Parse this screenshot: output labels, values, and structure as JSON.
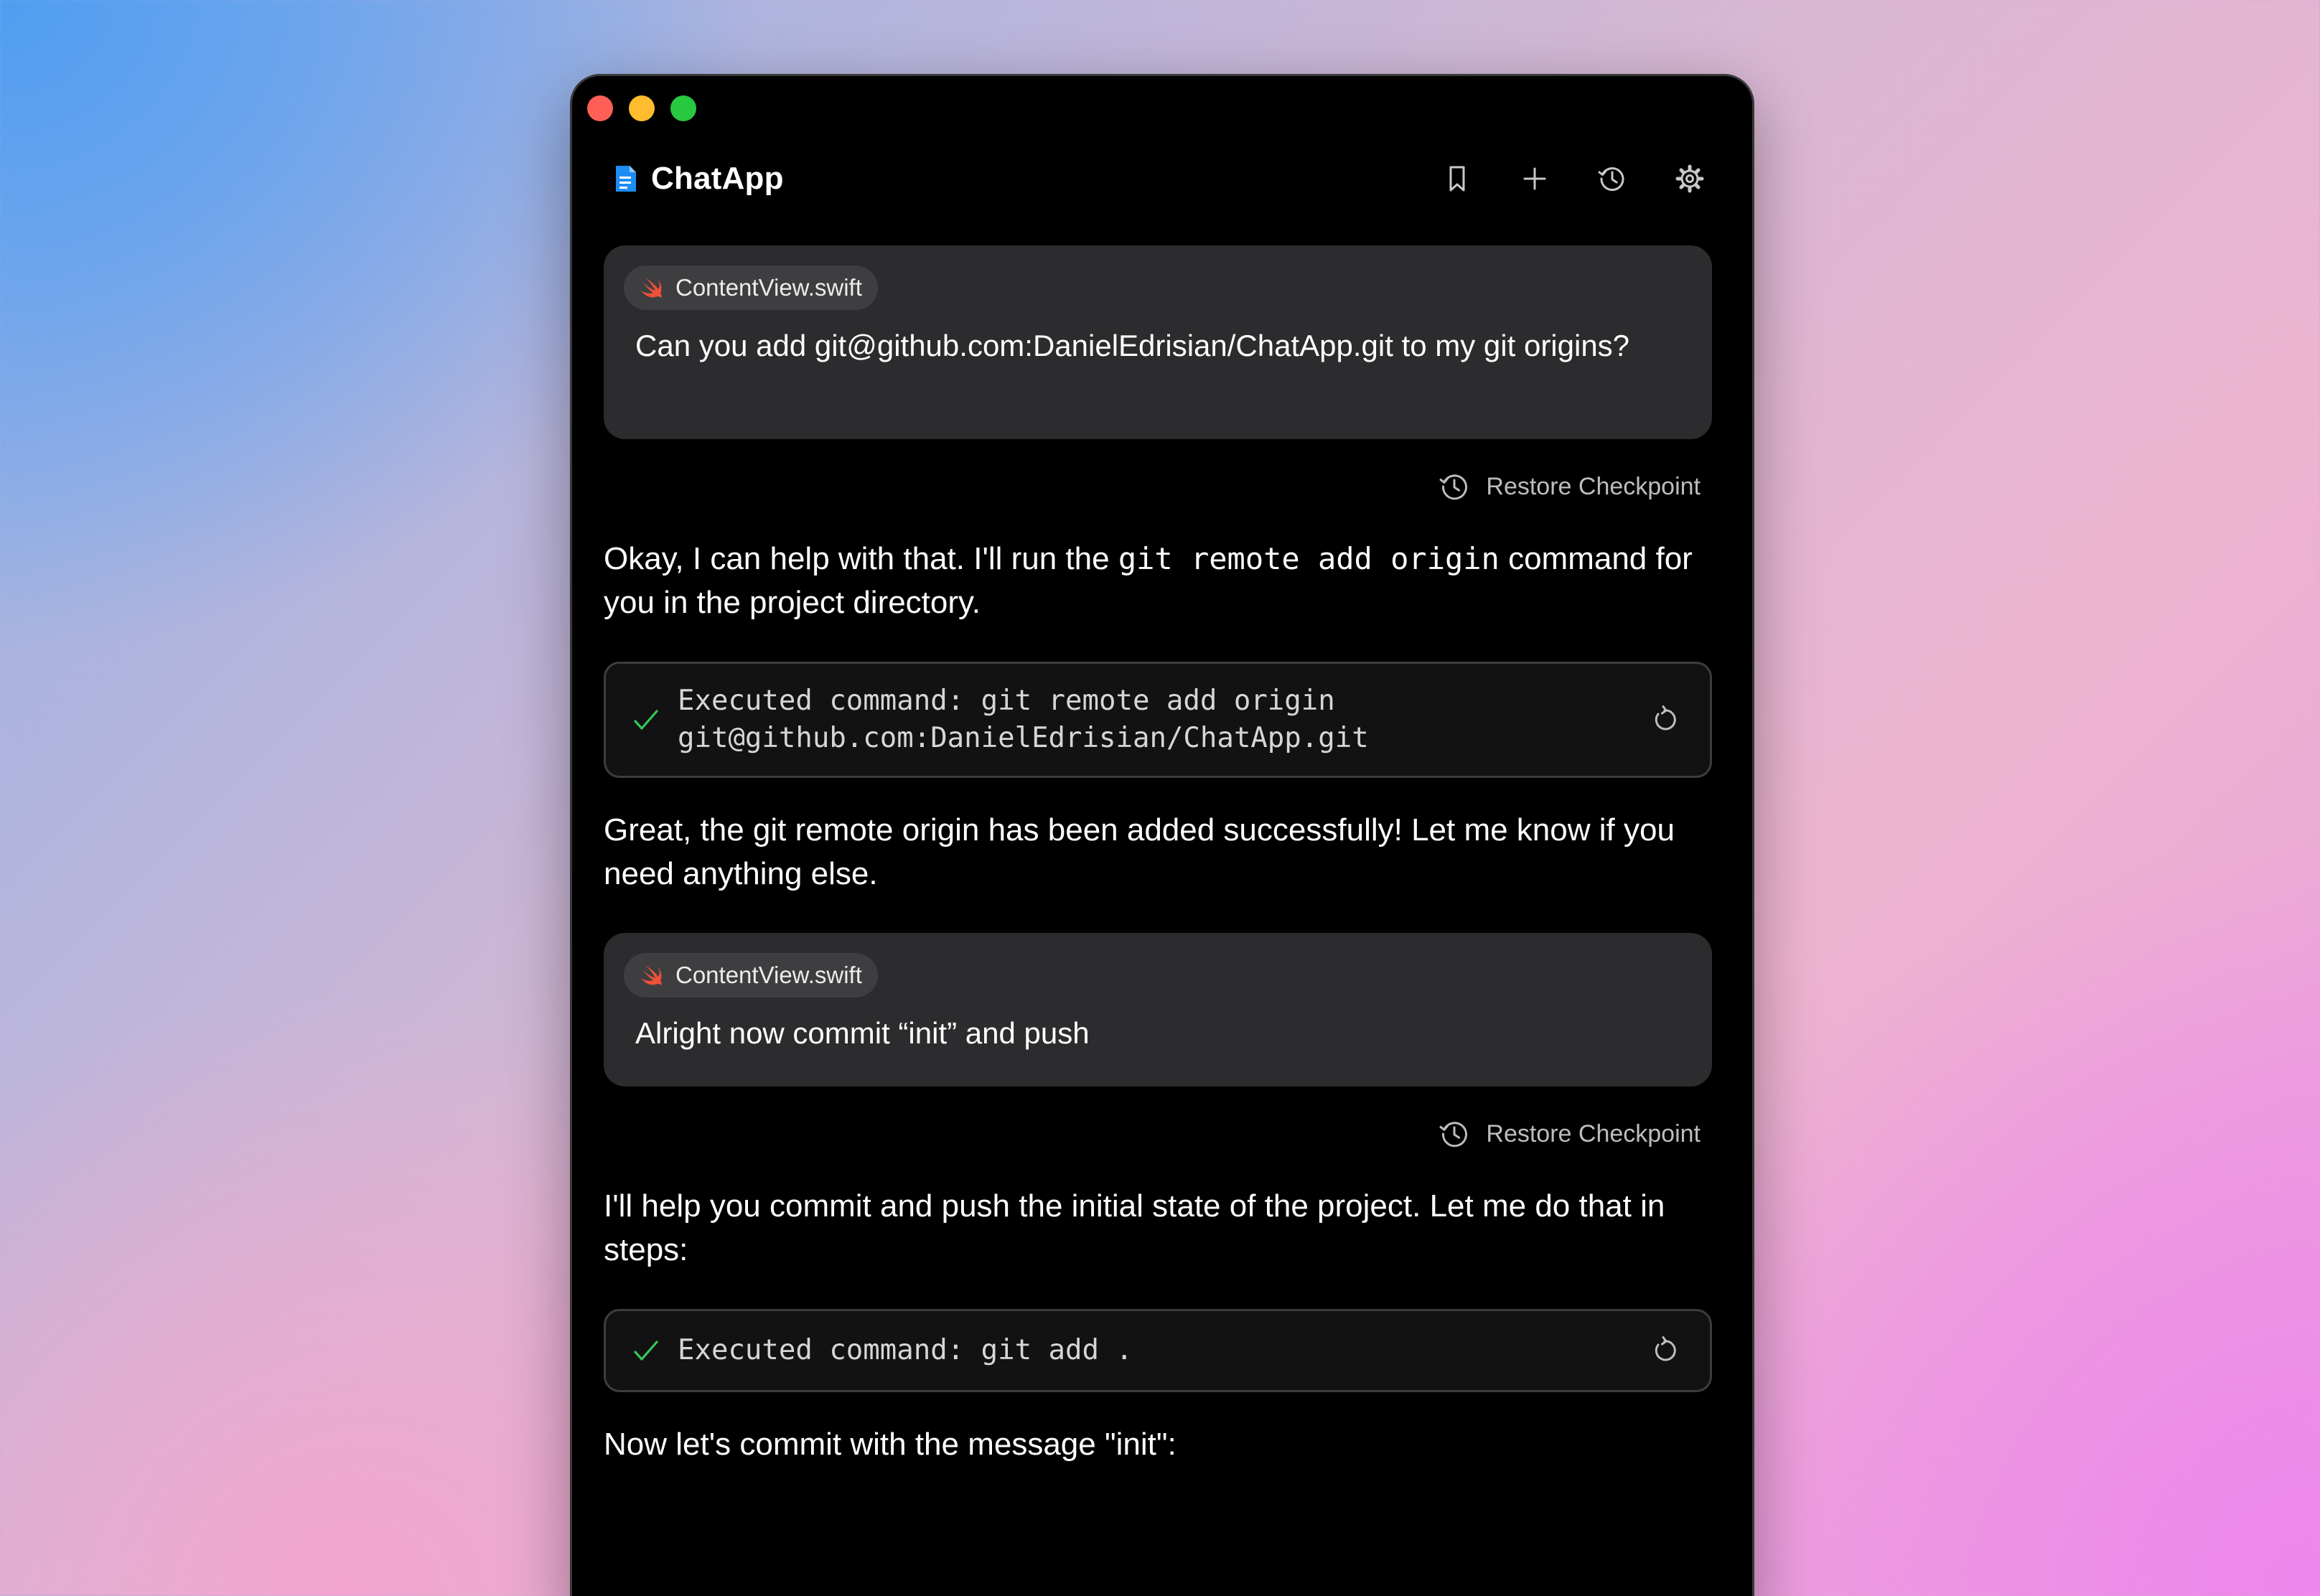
{
  "app": {
    "title": "ChatApp"
  },
  "icons": {
    "brand": "document-icon",
    "bookmark": "bookmark-icon",
    "new_chat": "plus-icon",
    "history": "history-icon",
    "settings": "gear-icon",
    "swift": "swift-icon",
    "restore": "history-icon",
    "check": "checkmark-icon",
    "retry": "retry-icon"
  },
  "colors": {
    "window_bg": "#000000",
    "bubble_bg": "#2c2c2e",
    "chip_bg": "#3e3e40",
    "swift_orange": "#f05138",
    "success_green": "#35c759",
    "brand_blue": "#1e8cf5"
  },
  "messages": [
    {
      "role": "user",
      "attachment": "ContentView.swift",
      "text": "Can you add git@github.com:DanielEdrisian/ChatApp.git to my git origins?",
      "action": "Restore Checkpoint"
    },
    {
      "role": "assistant",
      "text_before": "Okay, I can help with that. I'll run the ",
      "code": "git remote add origin",
      "text_after": " command for you in the project directory."
    },
    {
      "role": "tool",
      "status": "success",
      "command": "Executed command: git remote add origin git@github.com:DanielEdrisian/ChatApp.git"
    },
    {
      "role": "assistant",
      "text": "Great, the git remote origin has been added successfully! Let me know if you need anything else."
    },
    {
      "role": "user",
      "attachment": "ContentView.swift",
      "text": "Alright now commit “init” and push",
      "action": "Restore Checkpoint"
    },
    {
      "role": "assistant",
      "text": "I'll help you commit and push the initial state of the project. Let me do that in steps:"
    },
    {
      "role": "tool",
      "status": "success",
      "command": "Executed command: git add ."
    },
    {
      "role": "assistant",
      "text": "Now let's commit with the message \"init\":"
    }
  ]
}
